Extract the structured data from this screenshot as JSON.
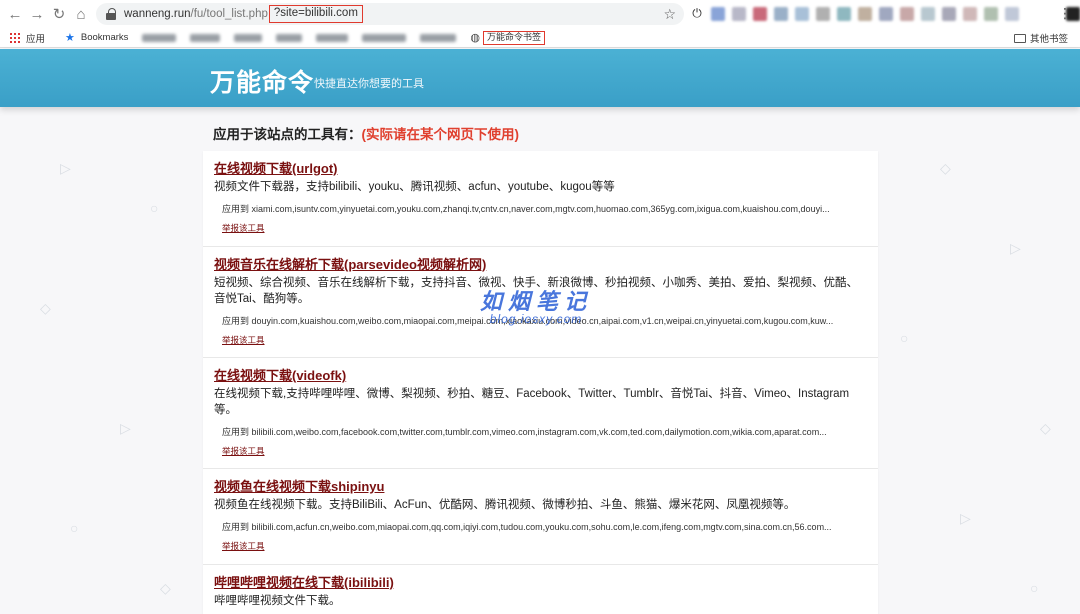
{
  "browser": {
    "url_host": "wanneng.run",
    "url_path": "/fu/tool_list.php",
    "url_query": "?site=bilibili.com",
    "bookmarks": {
      "apps_label": "应用",
      "bookmarks_label": "Bookmarks",
      "highlight_label": "万能命令书签",
      "other_label": "其他书签"
    }
  },
  "header": {
    "title": "万能命令",
    "subtitle": "快捷直达你想要的工具"
  },
  "section": {
    "heading": "应用于该站点的工具有：",
    "note": "(实际请在某个网页下使用)"
  },
  "tools": [
    {
      "title": "在线视频下载(urlgot)",
      "description": "视频文件下载器，支持bilibili、youku、腾讯视频、acfun、youtube、kugou等等",
      "sites": "应用到  xiami.com,isuntv.com,yinyuetai.com,youku.com,zhanqi.tv,cntv.cn,naver.com,mgtv.com,huomao.com,365yg.com,ixigua.com,kuaishou.com,douyi...",
      "report": "举报该工具"
    },
    {
      "title": "视频音乐在线解析下载(parsevideo视频解析网)",
      "description": "短视频、综合视频、音乐在线解析下载，支持抖音、微视、快手、新浪微博、秒拍视频、小咖秀、美拍、爱拍、梨视频、优酷、音悦Tai、酷狗等。",
      "sites": "应用到  douyin.com,kuaishou.com,weibo.com,miaopai.com,meipai.com,xiaokaxiu.com,video.cn,aipai.com,v1.cn,weipai.cn,yinyuetai.com,kugou.com,kuw...",
      "report": "举报该工具"
    },
    {
      "title": "在线视频下载(videofk)",
      "description": "在线视频下载,支持哔哩哔哩、微博、梨视频、秒拍、糖豆、Facebook、Twitter、Tumblr、音悦Tai、抖音、Vimeo、Instagram等。",
      "sites": "应用到  bilibili.com,weibo.com,facebook.com,twitter.com,tumblr.com,vimeo.com,instagram.com,vk.com,ted.com,dailymotion.com,wikia.com,aparat.com...",
      "report": "举报该工具"
    },
    {
      "title": "视频鱼在线视频下载shipinyu",
      "description": "视频鱼在线视频下载。支持BiliBili、AcFun、优酷网、腾讯视频、微博秒拍、斗鱼、熊猫、爆米花网、凤凰视频等。",
      "sites": "应用到  bilibili.com,acfun.cn,weibo.com,miaopai.com,qq.com,iqiyi.com,tudou.com,youku.com,sohu.com,le.com,ifeng.com,mgtv.com,sina.com.cn,56.com...",
      "report": "举报该工具"
    },
    {
      "title": "哔哩哔哩视频在线下载(ibilibili)",
      "description": "哔哩哔哩视频文件下载。"
    }
  ],
  "watermark": {
    "main": "如烟笔记",
    "sub": "blog.iosxy.com"
  }
}
